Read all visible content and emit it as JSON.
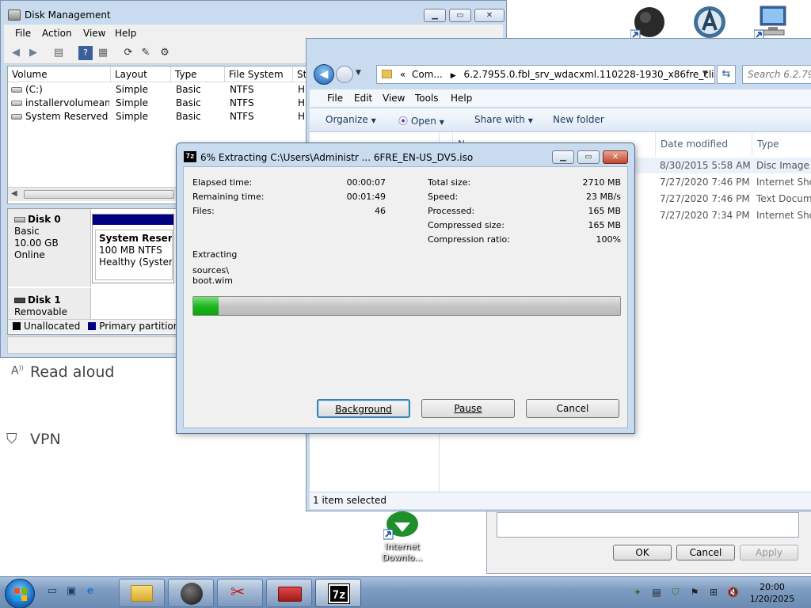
{
  "disk_management": {
    "title": "Disk Management",
    "menu": [
      "File",
      "Action",
      "View",
      "Help"
    ],
    "columns": [
      "Volume",
      "Layout",
      "Type",
      "File System",
      "St"
    ],
    "volumes": [
      {
        "name": "(C:)",
        "layout": "Simple",
        "type": "Basic",
        "fs": "NTFS",
        "status": "H"
      },
      {
        "name": "installervolumean...",
        "layout": "Simple",
        "type": "Basic",
        "fs": "NTFS",
        "status": "H"
      },
      {
        "name": "System Reserved",
        "layout": "Simple",
        "type": "Basic",
        "fs": "NTFS",
        "status": "H"
      }
    ],
    "disk0": {
      "name": "Disk 0",
      "type": "Basic",
      "size": "10.00 GB",
      "state": "Online"
    },
    "disk0_partition": {
      "name": "System Reserve",
      "size": "100 MB NTFS",
      "health": "Healthy (System,"
    },
    "disk1": {
      "name": "Disk 1",
      "type": "Removable (E:)"
    },
    "legend": {
      "unallocated": "Unallocated",
      "primary": "Primary partition"
    },
    "colors": {
      "unallocated": "#000000",
      "primary": "#000080"
    }
  },
  "settings_panel": {
    "read_aloud": "Read aloud",
    "vpn": "VPN"
  },
  "explorer": {
    "breadcrumb_prefix": "«",
    "breadcrumb_1": "Com...",
    "breadcrumb_2": "6.2.7955.0.fbl_srv_wdacxml.110228-1930_x86fre_client...",
    "search_placeholder": "Search 6.2.7955...",
    "menu": [
      "File",
      "Edit",
      "View",
      "Tools",
      "Help"
    ],
    "commands": {
      "organize": "Organize",
      "open": "Open",
      "share": "Share with",
      "new_folder": "New folder"
    },
    "columns": {
      "name": "N",
      "date": "Date modified",
      "type": "Type"
    },
    "rows": [
      {
        "date": "8/30/2015 5:58 AM",
        "type": "Disc Image Fi"
      },
      {
        "date": "7/27/2020 7:46 PM",
        "type": "Internet Short"
      },
      {
        "date": "7/27/2020 7:46 PM",
        "type": "Text Docume"
      },
      {
        "date": "7/27/2020 7:34 PM",
        "type": "Internet Short"
      }
    ],
    "status": "1 item selected"
  },
  "properties_dialog": {
    "ok": "OK",
    "cancel": "Cancel",
    "apply": "Apply"
  },
  "zip_dialog": {
    "title": "6% Extracting C:\\Users\\Administr ... 6FRE_EN-US_DV5.iso",
    "icon_text": "7z",
    "left_stats": [
      {
        "label": "Elapsed time:",
        "value": "00:00:07"
      },
      {
        "label": "Remaining time:",
        "value": "00:01:49"
      },
      {
        "label": "Files:",
        "value": "46"
      }
    ],
    "right_stats": [
      {
        "label": "Total size:",
        "value": "2710 MB"
      },
      {
        "label": "Speed:",
        "value": "23 MB/s"
      },
      {
        "label": "Processed:",
        "value": "165 MB"
      },
      {
        "label": "Compressed size:",
        "value": "165 MB"
      },
      {
        "label": "Compression ratio:",
        "value": "100%"
      }
    ],
    "extracting_label": "Extracting",
    "current_path": "sources\\",
    "current_file": "boot.wim",
    "progress_percent": 6,
    "buttons": {
      "background": "Background",
      "pause": "Pause",
      "cancel": "Cancel"
    }
  },
  "desktop": {
    "idm_label_1": "Internet",
    "idm_label_2": "Downlo..."
  },
  "taskbar": {
    "time": "20:00",
    "date": "1/20/2025",
    "task_7z": "7z"
  }
}
